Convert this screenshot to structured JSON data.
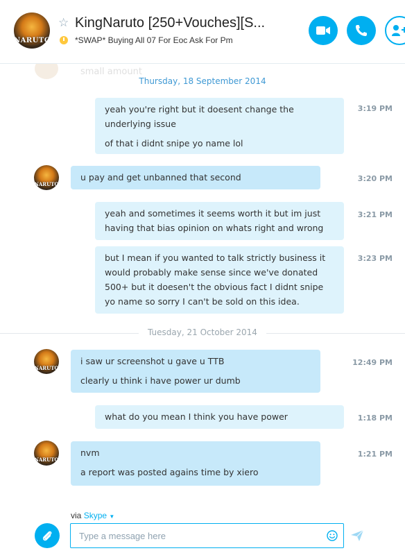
{
  "header": {
    "avatar_text": "NARUTO",
    "title": "KingNaruto [250+Vouches][S...",
    "mood": "*SWAP* Buying All 07 For Eoc Ask For Pm"
  },
  "chat": {
    "faded_prev": {
      "text": "small amount"
    },
    "dates": [
      "Thursday, 18 September 2014",
      "Tuesday, 21 October 2014"
    ],
    "messages": [
      {
        "paragraphs": [
          "yeah you're right but it doesent change the underlying issue",
          "of that i didnt snipe yo name lol"
        ],
        "time": "3:19 PM"
      },
      {
        "paragraphs": [
          "u pay and get unbanned that second"
        ],
        "time": "3:20 PM"
      },
      {
        "paragraphs": [
          "yeah and sometimes it seems worth it but im just having that bias opinion on whats right and wrong"
        ],
        "time": "3:21 PM"
      },
      {
        "paragraphs": [
          "but I mean if you wanted to talk strictly business it would probably make sense since we've donated 500+ but it doesen't the obvious fact I didnt snipe yo name so sorry I can't be sold on this idea."
        ],
        "time": "3:23 PM"
      },
      {
        "paragraphs": [
          "i saw ur screenshot u gave u TTB",
          "clearly u think i have power ur dumb"
        ],
        "time": "12:49 PM"
      },
      {
        "paragraphs": [
          "what do you mean I think you have power"
        ],
        "time": "1:18 PM"
      },
      {
        "paragraphs": [
          "nvm",
          "a report was posted agains time by xiero"
        ],
        "time": "1:21 PM"
      }
    ]
  },
  "footer": {
    "via_label": "via",
    "via_service": "Skype",
    "input_placeholder": "Type a message here"
  },
  "colors": {
    "accent": "#00aff0",
    "bubble_out": "#def3fc",
    "bubble_in": "#c7e9fa"
  },
  "icons": [
    "star-icon",
    "video-call-icon",
    "phone-icon",
    "add-contact-icon",
    "attach-icon",
    "emoji-icon",
    "send-icon"
  ]
}
